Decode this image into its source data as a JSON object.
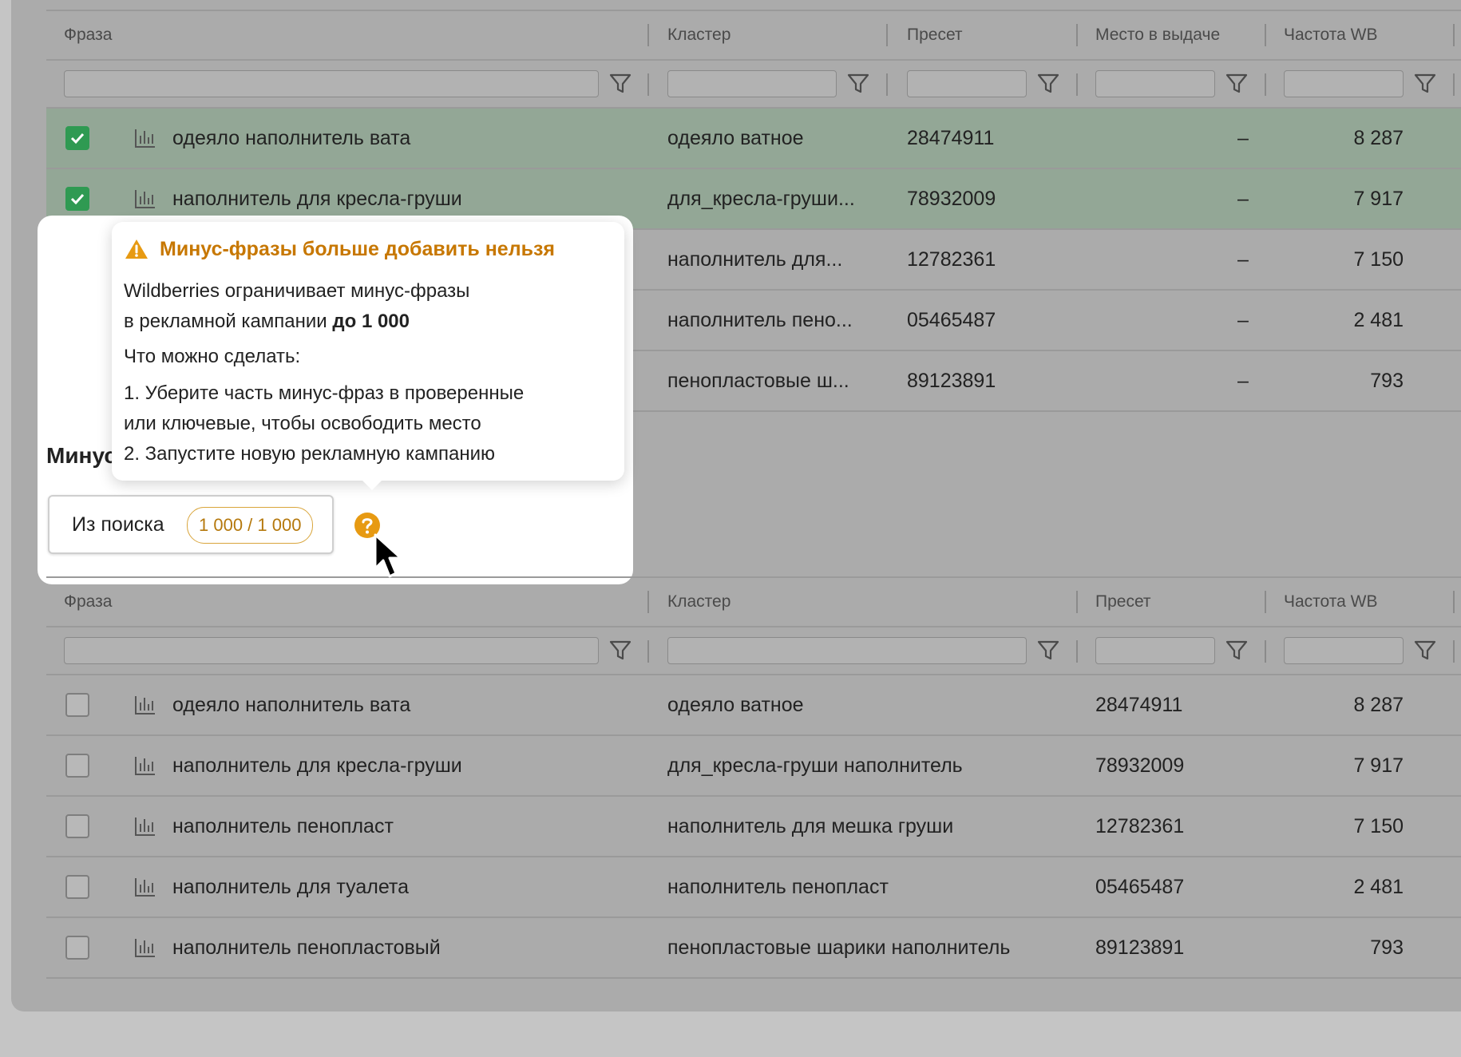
{
  "columns_top": {
    "phrase": "Фраза",
    "cluster": "Кластер",
    "preset": "Пресет",
    "place": "Место в выдаче",
    "freq": "Частота WB"
  },
  "top_rows": [
    {
      "checked": true,
      "phrase": "одеяло наполнитель вата",
      "cluster": "одеяло ватное",
      "preset": "28474911",
      "place": "–",
      "freq": "8 287"
    },
    {
      "checked": true,
      "phrase": "наполнитель для кресла-груши",
      "cluster": "для_кресла-груши...",
      "preset": "78932009",
      "place": "–",
      "freq": "7 917"
    },
    {
      "checked": false,
      "phrase": "",
      "cluster": "наполнитель для...",
      "preset": "12782361",
      "place": "–",
      "freq": "7 150"
    },
    {
      "checked": false,
      "phrase": "",
      "cluster": "наполнитель пено...",
      "preset": "05465487",
      "place": "–",
      "freq": "2 481"
    },
    {
      "checked": false,
      "phrase": "",
      "cluster": "пенопластовые ш...",
      "preset": "89123891",
      "place": "–",
      "freq": "793"
    }
  ],
  "section": {
    "title": "Минус",
    "chip_label": "Из поиска",
    "chip_count": "1 000 / 1 000"
  },
  "tooltip": {
    "title": "Минус-фразы больше добавить нельзя",
    "line1": "Wildberries ограничивает минус-фразы",
    "line2_prefix": "в рекламной кампании ",
    "line2_bold": "до 1 000",
    "line3": "Что можно сделать:",
    "line4": "1. Уберите часть минус-фраз в проверенные",
    "line5": "или ключевые, чтобы освободить место",
    "line6": "2. Запустите новую рекламную кампанию"
  },
  "columns_bottom": {
    "phrase": "Фраза",
    "cluster": "Кластер",
    "preset": "Пресет",
    "freq": "Частота WB"
  },
  "bottom_rows": [
    {
      "phrase": "одеяло наполнитель вата",
      "cluster": "одеяло ватное",
      "preset": "28474911",
      "freq": "8 287"
    },
    {
      "phrase": "наполнитель для кресла-груши",
      "cluster": "для_кресла-груши наполнитель",
      "preset": "78932009",
      "freq": "7 917"
    },
    {
      "phrase": "наполнитель пенопласт",
      "cluster": "наполнитель для мешка груши",
      "preset": "12782361",
      "freq": "7 150"
    },
    {
      "phrase": "наполнитель для туалета",
      "cluster": "наполнитель пенопласт",
      "preset": "05465487",
      "freq": "2 481"
    },
    {
      "phrase": "наполнитель пенопластовый",
      "cluster": "пенопластовые шарики наполнитель",
      "preset": "89123891",
      "freq": "793"
    }
  ],
  "colors": {
    "accent_warning": "#c77700",
    "checkbox_checked": "#2f9a52",
    "selected_row": "#93a796"
  }
}
